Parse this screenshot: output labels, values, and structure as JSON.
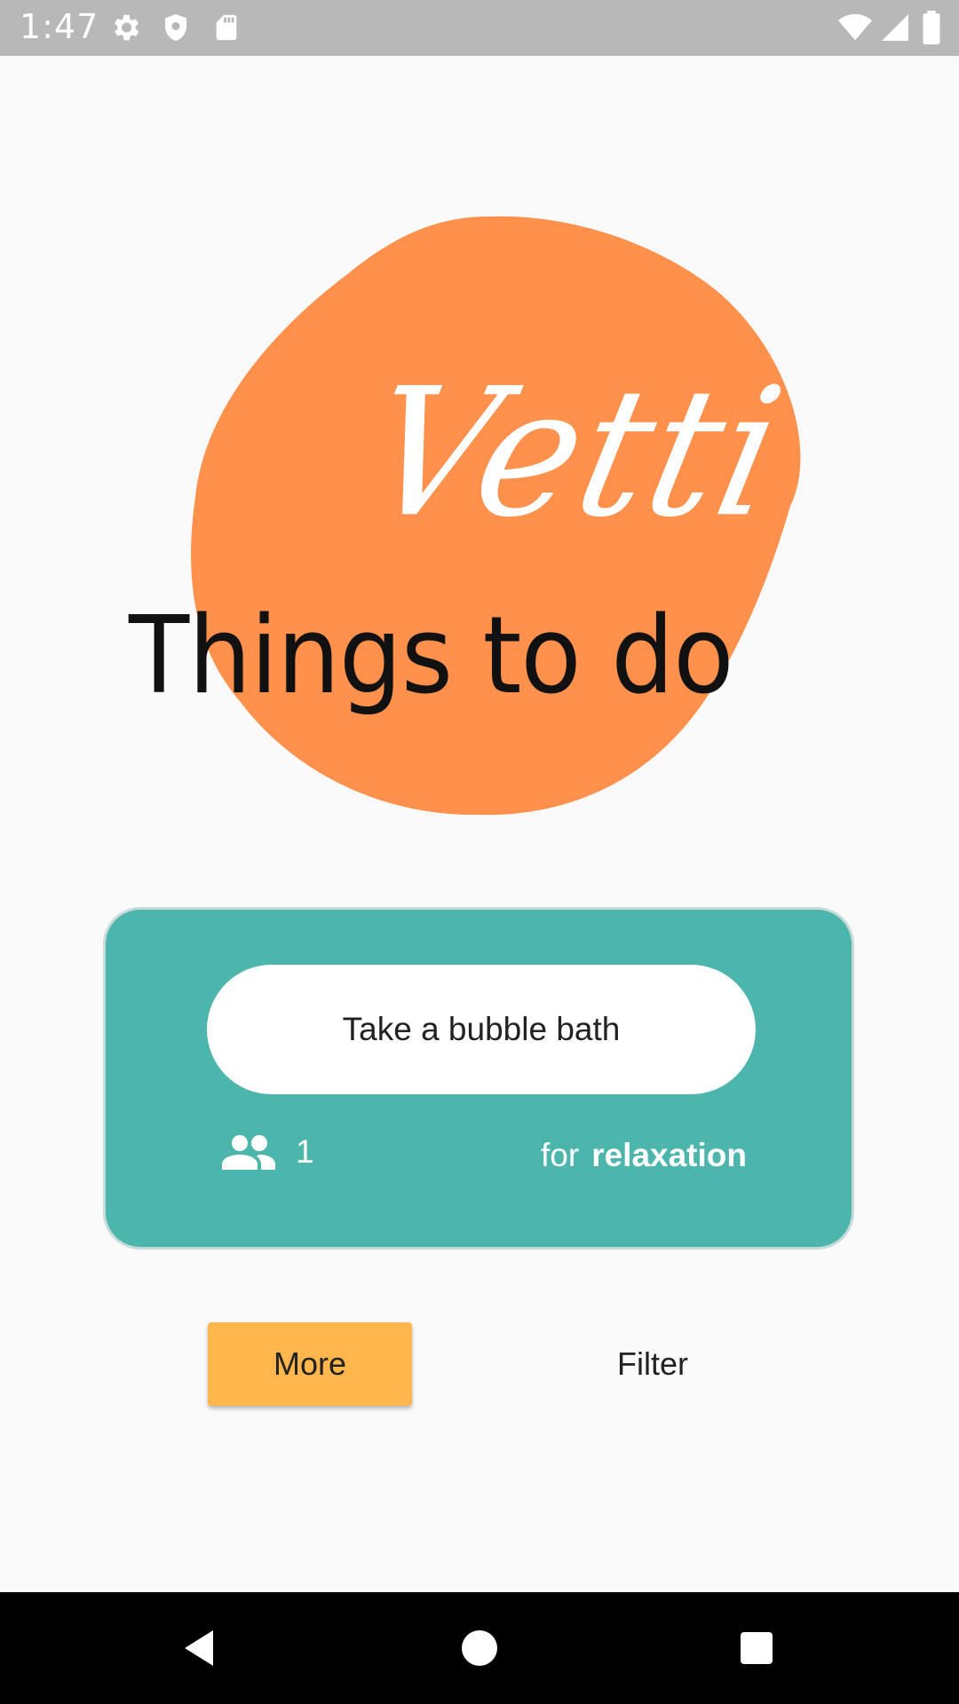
{
  "status_bar": {
    "time": "1:47",
    "icons": [
      "gear-icon",
      "shield-icon",
      "sd-card-icon",
      "wifi-icon",
      "signal-icon",
      "battery-icon"
    ],
    "color": "#b8b8b8"
  },
  "logo": {
    "script_text": "Vetti",
    "tagline": "Things to do",
    "blob_color": "#ff914d"
  },
  "activity_card": {
    "activity": "Take a bubble bath",
    "participants": "1",
    "for_label": "for",
    "type": "relaxation",
    "card_color": "#4db6ac"
  },
  "actions": {
    "more_label": "More",
    "filter_label": "Filter",
    "more_color": "#ffb74d"
  },
  "nav_bar": {
    "buttons": [
      "back-icon",
      "home-icon",
      "recents-icon"
    ]
  }
}
